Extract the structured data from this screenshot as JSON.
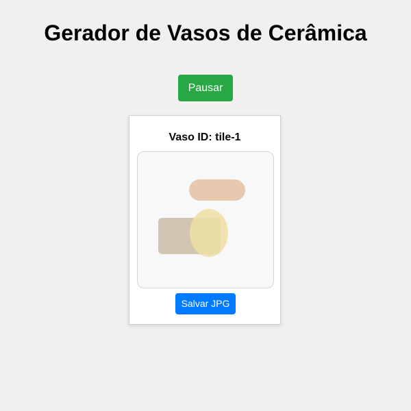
{
  "header": {
    "title": "Gerador de Vasos de Cerâmica"
  },
  "controls": {
    "toggle_label": "Pausar",
    "toggle_color": "#28a745"
  },
  "tile": {
    "id_label": "Vaso ID: tile-1",
    "save_label": "Salvar JPG",
    "save_color": "#007bff",
    "shapes": [
      {
        "kind": "pill",
        "color": "#e3c3a6"
      },
      {
        "kind": "rounded-rect",
        "color": "#cbbca6"
      },
      {
        "kind": "ellipse",
        "color": "#eedfa4"
      }
    ]
  }
}
